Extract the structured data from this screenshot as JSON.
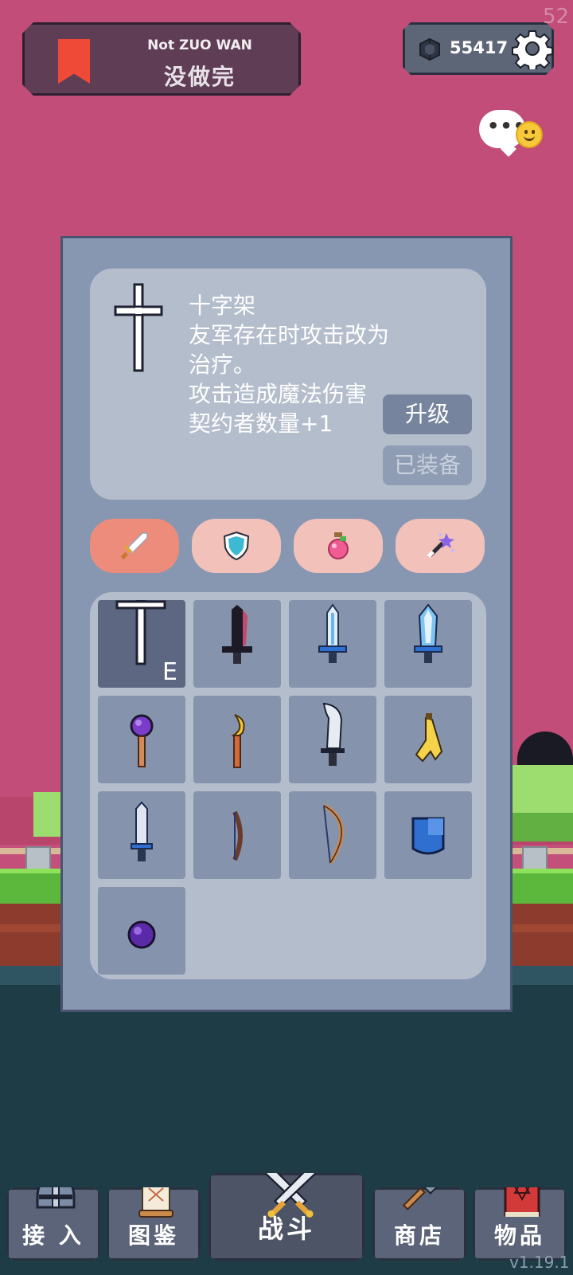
{
  "top_bar": {
    "quest_subtitle": "Not ZUO WAN",
    "quest_title": "没做完",
    "gem_count": "55417",
    "fps": "52"
  },
  "chat": {
    "dots": "•••"
  },
  "item_detail": {
    "name": "十字架",
    "lines": [
      "友军存在时攻击改为",
      "治疗。",
      "攻击造成魔法伤害",
      "契约者数量+1"
    ],
    "upgrade_label": "升级",
    "equipped_label": "已装备"
  },
  "categories": [
    {
      "icon": "sword-icon",
      "active": true
    },
    {
      "icon": "shield-icon",
      "active": false
    },
    {
      "icon": "potion-icon",
      "active": false
    },
    {
      "icon": "magic-wand-icon",
      "active": false
    }
  ],
  "inventory": {
    "equipped_mark": "E",
    "items": [
      "cross-icon",
      "dark-dagger-icon",
      "ice-sword-icon",
      "crystal-sword-icon",
      "purple-staff-icon",
      "moon-staff-icon",
      "machete-icon",
      "banana-icon",
      "short-sword-icon",
      "bow-icon",
      "longbow-icon",
      "blue-shield-icon",
      "dark-orb-icon"
    ]
  },
  "nav": {
    "recruit_label": "接 入",
    "codex_label": "图鉴",
    "battle_label": "战斗",
    "shop_label": "商店",
    "items_label": "物品"
  },
  "version": "v1.19.1",
  "colors": {
    "sky": "#c24d78",
    "panel": "#8797b2",
    "card": "#b4bdcc",
    "tab_active": "#ee8c7c",
    "tab_inactive": "#f2c2ba"
  }
}
